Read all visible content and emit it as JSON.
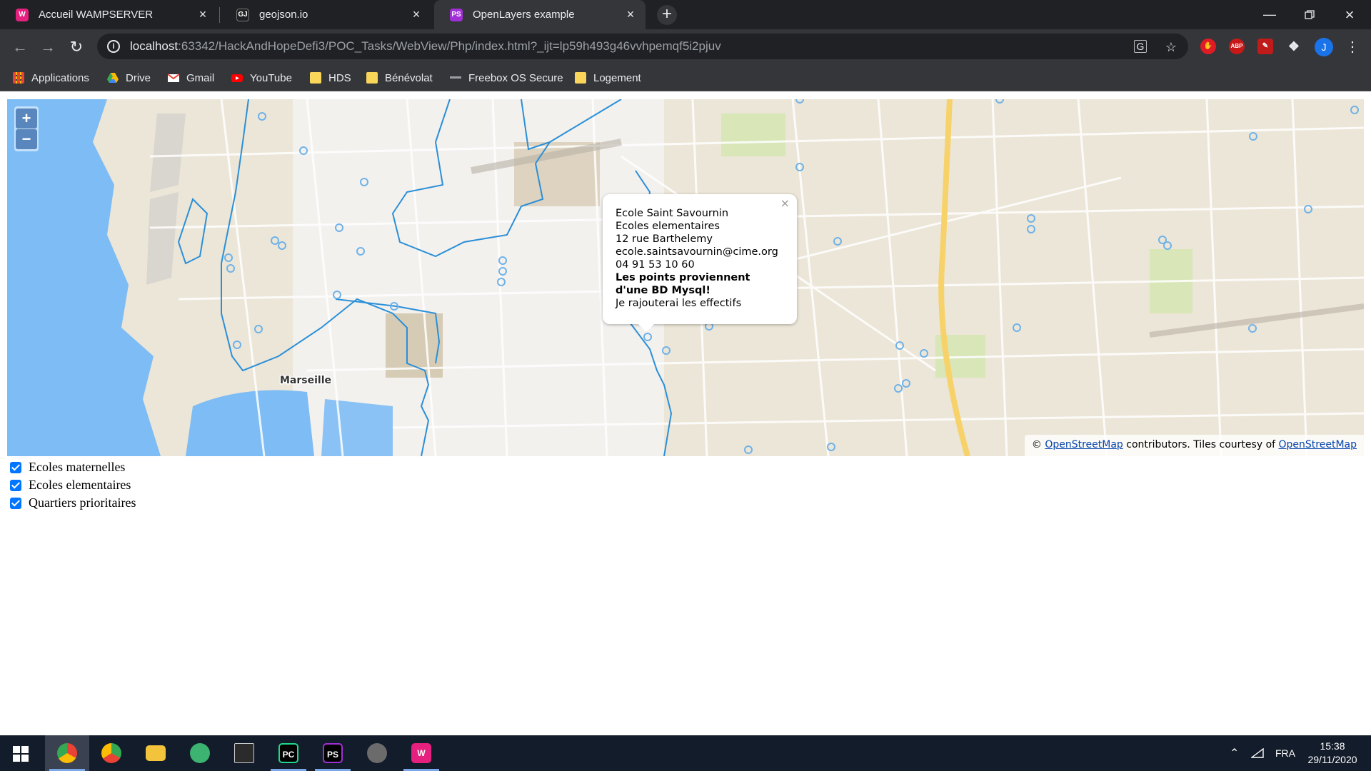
{
  "browser": {
    "tabs": [
      {
        "title": "Accueil WAMPSERVER",
        "favicon": "wampserver-icon",
        "favicon_color": "#e5207e",
        "active": false
      },
      {
        "title": "geojson.io",
        "favicon": "geojson-icon",
        "favicon_color": "#202124",
        "active": false
      },
      {
        "title": "OpenLayers example",
        "favicon": "phpstorm-icon",
        "favicon_color": "#a12fd6",
        "active": true
      }
    ],
    "url_host": "localhost",
    "url_rest": ":63342/HackAndHopeDefi3/POC_Tasks/WebView/Php/index.html?_ijt=lp59h493g46vvhpemqf5i2pjuv",
    "profile_initial": "J",
    "extensions": [
      {
        "name": "adblock-icon",
        "label": "",
        "color": "#e01b24"
      },
      {
        "name": "abp-icon",
        "label": "ABP",
        "color": "#c91818"
      },
      {
        "name": "pdf-icon",
        "label": "",
        "color": "#c01b1b"
      }
    ]
  },
  "bookmarks": [
    {
      "label": "Applications",
      "icon": "apps-grid-icon"
    },
    {
      "label": "Drive",
      "icon": "drive-icon"
    },
    {
      "label": "Gmail",
      "icon": "gmail-icon"
    },
    {
      "label": "YouTube",
      "icon": "youtube-icon"
    },
    {
      "label": "HDS",
      "icon": "folder-icon"
    },
    {
      "label": "Bénévolat",
      "icon": "folder-icon"
    },
    {
      "label": "Freebox OS Secure",
      "icon": "freebox-icon"
    },
    {
      "label": "Logement",
      "icon": "folder-icon"
    }
  ],
  "map": {
    "city_label": "Marseille",
    "zoom_in": "+",
    "zoom_out": "−",
    "popup": {
      "line1": "Ecole Saint Savournin",
      "line2": "Ecoles elementaires",
      "line3": "12 rue Barthelemy",
      "line4": "ecole.saintsavournin@cime.org",
      "line5": "04 91 53 10 60",
      "bold1": "Les points proviennent",
      "bold2": "d'une BD Mysql!",
      "line6": "Je rajouterai les effectifs",
      "close": "×"
    },
    "attribution": {
      "prefix": "©",
      "link1": "OpenStreetMap",
      "middle": "contributors. Tiles courtesy of",
      "link2": "OpenStreetMap"
    },
    "colors": {
      "water": "#7ebcf5",
      "land": "#ece6d8",
      "polygon": "#2a8fd8",
      "point": "#6fb2e8",
      "road": "#f7d26a"
    }
  },
  "layers": [
    {
      "label": "Ecoles maternelles",
      "checked": true
    },
    {
      "label": "Ecoles elementaires",
      "checked": true
    },
    {
      "label": "Quartiers prioritaires",
      "checked": true
    }
  ],
  "taskbar": {
    "apps": [
      {
        "name": "chrome-icon",
        "color": "#e8453c",
        "label": "",
        "active": true
      },
      {
        "name": "chrome-alt-icon",
        "color": "#34a853",
        "label": "",
        "active": false
      },
      {
        "name": "file-explorer-icon",
        "color": "#f3c33b",
        "label": "",
        "active": false
      },
      {
        "name": "atom-icon",
        "color": "#3cb371",
        "label": "",
        "active": false
      },
      {
        "name": "terminal-icon",
        "color": "#2b2b2b",
        "label": "",
        "active": false
      },
      {
        "name": "pycharm-icon",
        "color": "#21d789",
        "label": "PC",
        "active": false
      },
      {
        "name": "phpstorm-icon",
        "color": "#a12fd6",
        "label": "PS",
        "active": false
      },
      {
        "name": "app-grey-icon",
        "color": "#6b6b6b",
        "label": "",
        "active": false
      },
      {
        "name": "wampserver-icon",
        "color": "#e5207e",
        "label": "W",
        "active": false
      }
    ],
    "language": "FRA",
    "time": "15:38",
    "date": "29/11/2020"
  }
}
